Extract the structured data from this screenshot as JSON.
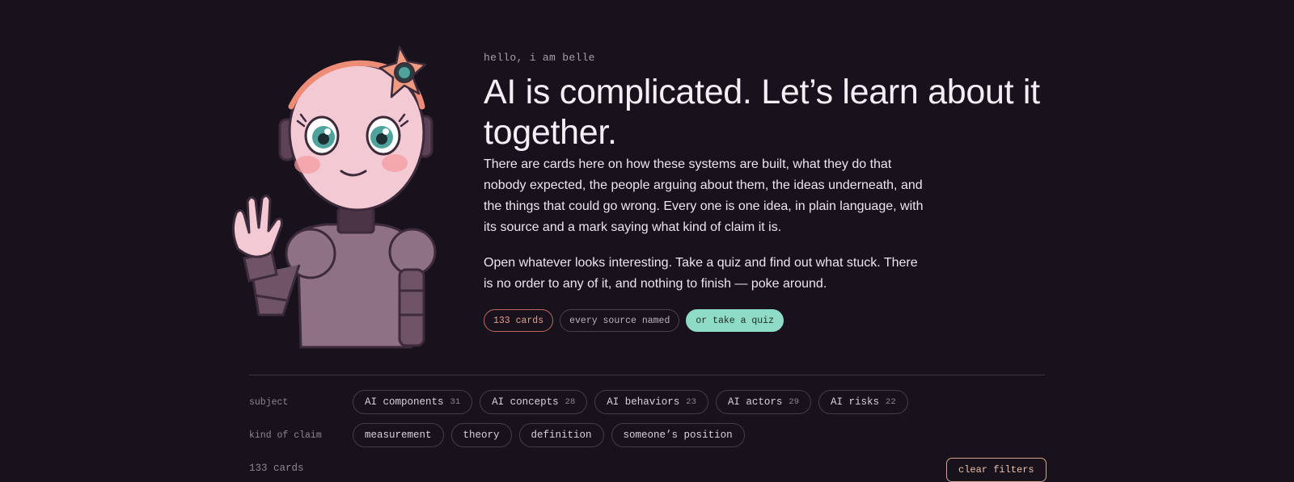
{
  "hero": {
    "eyebrow": "hello, i am belle",
    "headline": "AI is complicated. Let’s learn about it together.",
    "paragraph_1": "There are cards here on how these systems are built, what they do that nobody expected, the people arguing about them, the ideas underneath, and the things that could go wrong. Every one is one idea, in plain language, with its source and a mark saying what kind of claim it is.",
    "paragraph_2": "Open whatever looks interesting. Take a quiz and find out what stuck. There is no order to any of it, and nothing to finish — poke around.",
    "chips": {
      "count": "133 cards",
      "source": "every source named",
      "quiz": "or take a quiz"
    }
  },
  "mascot": {
    "icon": "robot-mascot-waving",
    "colors": {
      "skin": "#f3c9d4",
      "hair_band": "#ee8d77",
      "body": "#8e7185",
      "outline": "#3d2a3a",
      "eyes": "#4fa39c"
    }
  },
  "filters": {
    "subject": {
      "label": "subject",
      "options": [
        {
          "label": "AI components",
          "count": "31"
        },
        {
          "label": "AI concepts",
          "count": "28"
        },
        {
          "label": "AI behaviors",
          "count": "23"
        },
        {
          "label": "AI actors",
          "count": "29"
        },
        {
          "label": "AI risks",
          "count": "22"
        }
      ]
    },
    "kind": {
      "label": "kind of claim",
      "options": [
        {
          "label": "measurement"
        },
        {
          "label": "theory"
        },
        {
          "label": "definition"
        },
        {
          "label": "someone’s position"
        }
      ]
    }
  },
  "results": {
    "count_label": "133 cards",
    "clear_label": "clear filters"
  },
  "colors": {
    "background": "#17121b",
    "accent_mint": "#8fdcc6",
    "accent_coral": "#ec9c8e"
  }
}
